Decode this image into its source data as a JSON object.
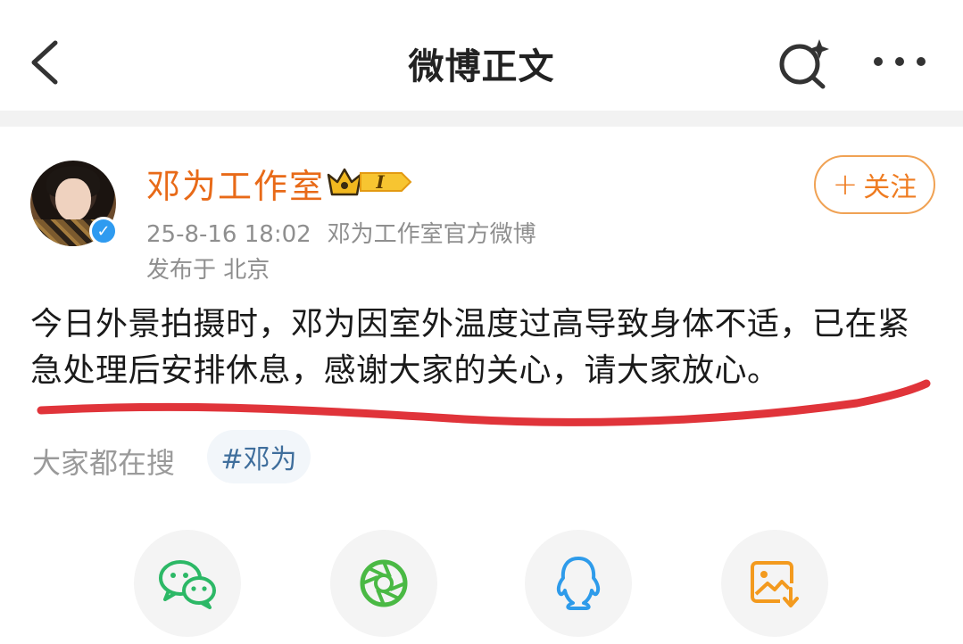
{
  "header": {
    "title": "微博正文",
    "back_icon": "back-arrow-icon",
    "search_icon": "search-sparkle-icon",
    "more_icon": "more-dots-icon"
  },
  "post": {
    "author": "邓为工作室",
    "vip_level": "I",
    "timestamp": "25-8-16 18:02",
    "source": "邓为工作室官方微博",
    "location": "发布于 北京",
    "follow_label": "关注",
    "text": "今日外景拍摄时，邓为因室外温度过高导致身体不适，已在紧急处理后安排休息，感谢大家的关心，请大家放心。"
  },
  "trending": {
    "label": "大家都在搜",
    "tag": "#邓为"
  },
  "share": {
    "icons": [
      "wechat-icon",
      "moments-icon",
      "qq-icon",
      "save-image-icon"
    ]
  },
  "colors": {
    "username": "#e86a18",
    "follow": "#ef7c21",
    "annotation": "#e0343a",
    "verified": "#2f9bf0"
  }
}
